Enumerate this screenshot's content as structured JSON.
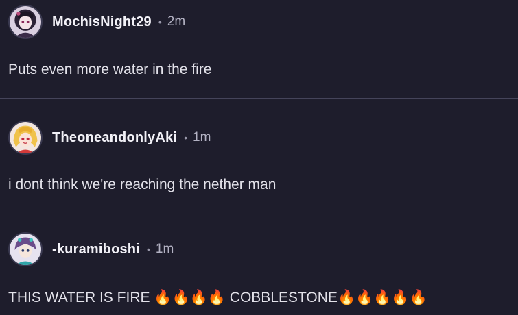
{
  "comments": [
    {
      "username": "MochisNight29",
      "separator": "•",
      "time": "2m",
      "text": "Puts even more water in the fire",
      "avatar_icon": "anime-girl-purple-avatar"
    },
    {
      "username": "TheoneandonlyAki",
      "separator": "•",
      "time": "1m",
      "text": "i dont think we're reaching the nether man",
      "avatar_icon": "anime-girl-blonde-avatar"
    },
    {
      "username": "-kuramiboshi",
      "separator": "•",
      "time": "1m",
      "text_before": "THIS WATER IS FIRE ",
      "fire_group_1": "🔥🔥🔥🔥",
      "text_middle": " COBBLESTONE",
      "fire_group_2": "🔥🔥🔥🔥🔥",
      "avatar_icon": "anime-boy-teal-avatar"
    }
  ],
  "colors": {
    "background": "#1e1d2c",
    "divider": "#45445a",
    "username": "#f2f1f7",
    "timestamp": "#b3b2c3",
    "fire": "#ff7a1a"
  }
}
